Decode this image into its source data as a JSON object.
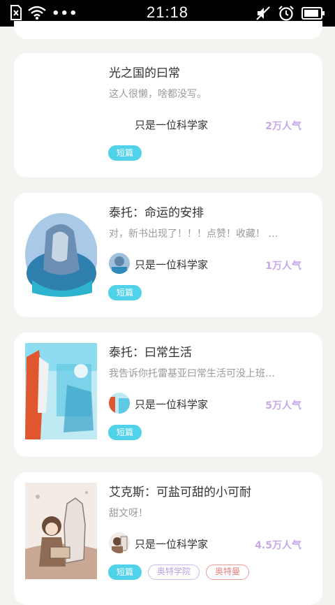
{
  "status_bar": {
    "time": "21:18",
    "icons": [
      "sim-error-icon",
      "wifi-icon",
      "more-dots-icon",
      "mute-icon",
      "alarm-icon",
      "battery-icon"
    ]
  },
  "colors": {
    "background": "#f4f3ef",
    "card": "#ffffff",
    "tag_short": "#4fd2ea",
    "popularity": "#c6a9e6",
    "tag_purple": "#b9a0e2",
    "tag_red": "#e7817f"
  },
  "books": [
    {
      "title": "光之国的曰常",
      "description": "这人很懒，啥都没写。",
      "author": "只是一位科学家",
      "popularity": "2万人气",
      "tags": [
        "短篇"
      ]
    },
    {
      "title": "泰托：命运的安排",
      "description": "对，新书出现了！！！点赞！收藏！ …",
      "author": "只是一位科学家",
      "popularity": "1万人气",
      "tags": [
        "短篇"
      ]
    },
    {
      "title": "泰托：曰常生活",
      "description": "我告诉你托雷基亚曰常生活可没上班…",
      "author": "只是一位科学家",
      "popularity": "5万人气",
      "tags": [
        "短篇"
      ]
    },
    {
      "title": "艾克斯：可盐可甜的小可耐",
      "description": "甜文呀！",
      "author": "只是一位科学家",
      "popularity": "4.5万人气",
      "tags": [
        "短篇",
        "奥特学院",
        "奥特曼"
      ]
    }
  ]
}
